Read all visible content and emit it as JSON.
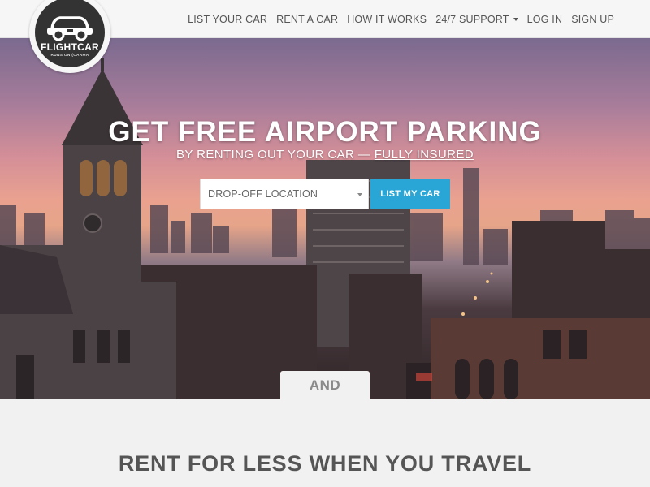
{
  "brand": {
    "name": "FLIGHTCAR",
    "tagline": "RUNS ON (CARMA"
  },
  "nav": {
    "items": [
      {
        "label": "LIST YOUR CAR"
      },
      {
        "label": "RENT A CAR"
      },
      {
        "label": "HOW IT WORKS"
      },
      {
        "label": "24/7 SUPPORT",
        "has_dropdown": true
      },
      {
        "label": "LOG IN"
      },
      {
        "label": "SIGN UP"
      }
    ]
  },
  "hero": {
    "headline": "GET FREE AIRPORT PARKING",
    "subline_prefix": "BY RENTING OUT YOUR CAR — ",
    "subline_link": "FULLY INSURED",
    "location_select": {
      "selected": "DROP-OFF LOCATION"
    },
    "cta_label": "LIST MY CAR"
  },
  "and_tab": "AND",
  "section_heading": "RENT FOR LESS WHEN YOU TRAVEL",
  "colors": {
    "accent": "#2aa6d6",
    "nav_text": "#555555",
    "logo_bg": "#333333"
  }
}
